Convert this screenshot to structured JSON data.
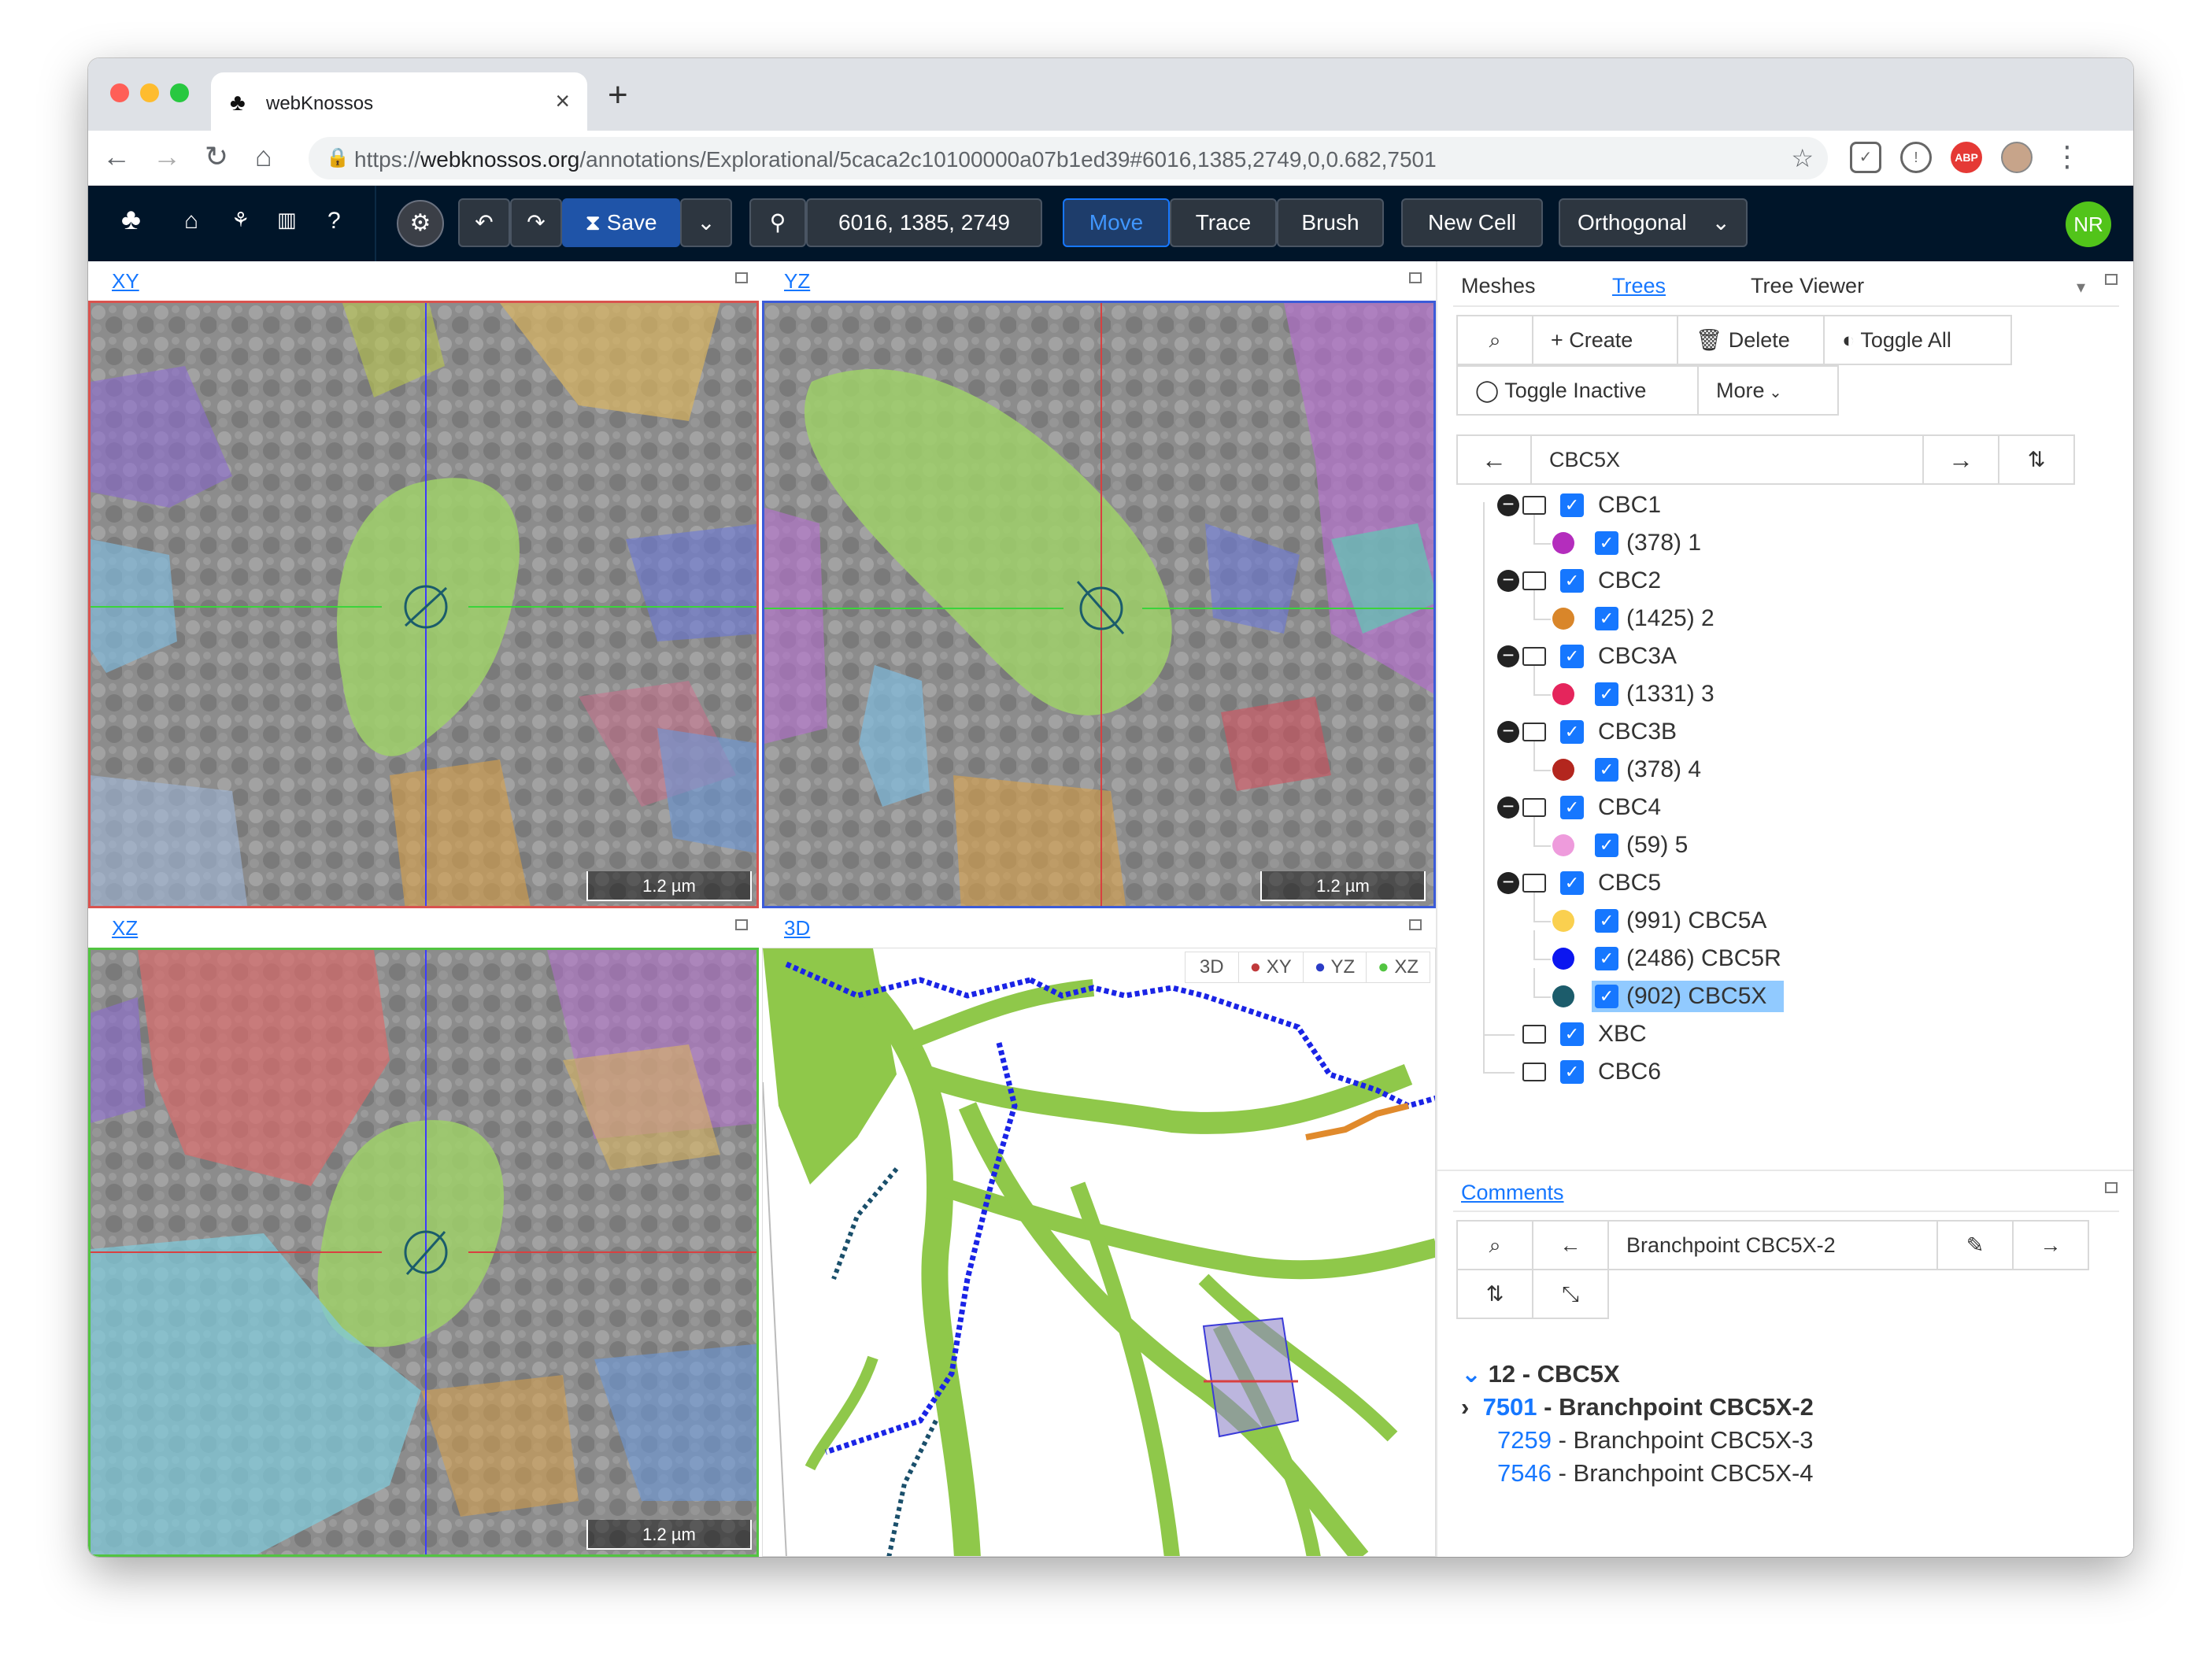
{
  "browser": {
    "tab_title": "webKnossos",
    "url_prefix": "https://",
    "url_host": "webknossos.org",
    "url_path": "/annotations/Explorational/5caca2c10100000a07b1ed39#6016,1385,2749,0,0.682,7501",
    "traffic_colors": [
      "#ff5f57",
      "#febc2e",
      "#28c840"
    ],
    "ext_abp": "ABP"
  },
  "toolbar": {
    "save_label": "Save",
    "position_value": "6016, 1385, 2749",
    "tools": [
      "Move",
      "Trace",
      "Brush"
    ],
    "active_tool": "Move",
    "new_cell_label": "New Cell",
    "view_mode": "Orthogonal",
    "user_initials": "NR"
  },
  "viewports": {
    "xy_label": "XY",
    "yz_label": "YZ",
    "xz_label": "XZ",
    "td_label": "3D",
    "scale_label": "1.2 µm",
    "td_buttons": [
      "3D",
      "XY",
      "YZ",
      "XZ"
    ]
  },
  "right_panel": {
    "tabs": [
      "Meshes",
      "Trees",
      "Tree Viewer"
    ],
    "active_tab": "Trees",
    "buttons": {
      "create": "Create",
      "delete": "Delete",
      "toggle_all": "Toggle All",
      "toggle_inactive": "Toggle Inactive",
      "more": "More"
    },
    "active_tree_name": "CBC5X",
    "groups": [
      {
        "name": "CBC1",
        "trees": [
          {
            "label": "(378) 1",
            "color": "#b42dbd"
          }
        ]
      },
      {
        "name": "CBC2",
        "trees": [
          {
            "label": "(1425) 2",
            "color": "#d9862a"
          }
        ]
      },
      {
        "name": "CBC3A",
        "trees": [
          {
            "label": "(1331) 3",
            "color": "#e5255c"
          }
        ]
      },
      {
        "name": "CBC3B",
        "trees": [
          {
            "label": "(378) 4",
            "color": "#b3261e"
          }
        ]
      },
      {
        "name": "CBC4",
        "trees": [
          {
            "label": "(59) 5",
            "color": "#ee9bdc"
          }
        ]
      },
      {
        "name": "CBC5",
        "trees": [
          {
            "label": "(991) CBC5A",
            "color": "#fad04f"
          },
          {
            "label": "(2486) CBC5R",
            "color": "#0b16f0"
          },
          {
            "label": "(902) CBC5X",
            "color": "#1c5c6b",
            "selected": true
          }
        ]
      },
      {
        "name": "XBC",
        "trees": []
      },
      {
        "name": "CBC6",
        "trees": []
      }
    ]
  },
  "comments": {
    "tab_label": "Comments",
    "current_comment": "Branchpoint CBC5X-2",
    "tree_header": "12 - CBC5X",
    "items": [
      {
        "id": "7501",
        "text": " - Branchpoint CBC5X-2",
        "active": true
      },
      {
        "id": "7259",
        "text": " - Branchpoint CBC5X-3",
        "active": false
      },
      {
        "id": "7546",
        "text": " - Branchpoint CBC5X-4",
        "active": false
      }
    ]
  }
}
